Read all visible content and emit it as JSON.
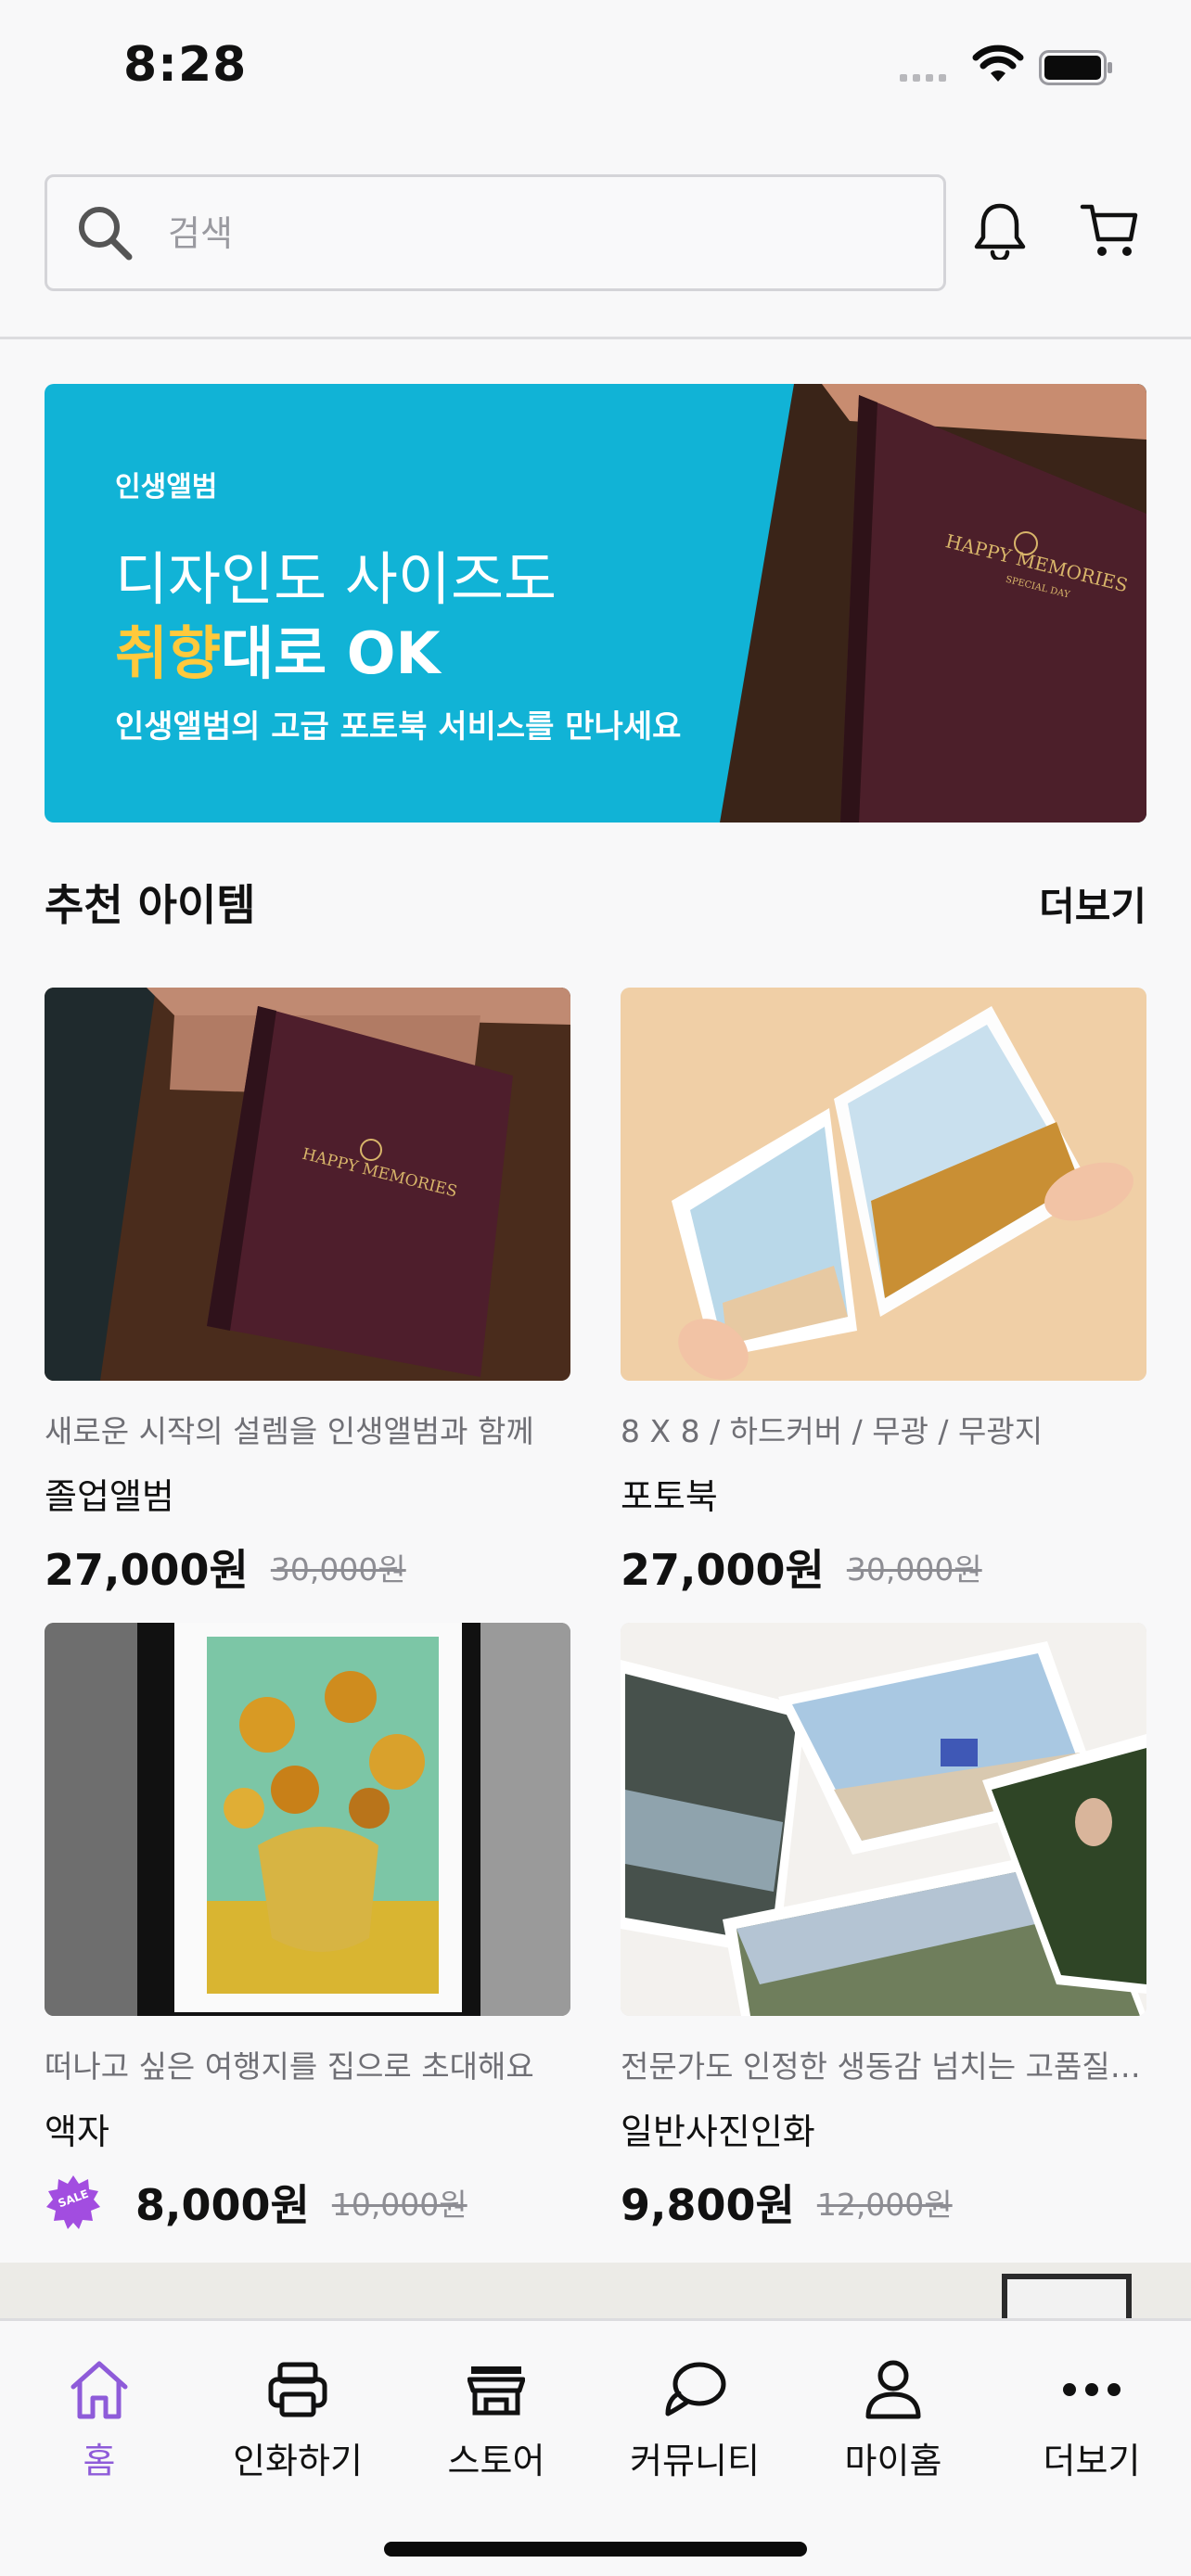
{
  "status_bar": {
    "time": "8:28"
  },
  "search": {
    "placeholder": "검색",
    "value": ""
  },
  "banner": {
    "eyebrow": "인생앨범",
    "line1": "디자인도 사이즈도",
    "line2_highlight": "취향",
    "line2_rest": "대로 OK",
    "subtitle": "인생앨범의 고급 포토북 서비스를 만나세요",
    "art_cover_title": "HAPPY MEMORIES",
    "art_cover_subtitle": "SPECIAL DAY",
    "background_color": "#11b3d6",
    "highlight_color": "#ffc93c"
  },
  "section": {
    "title": "추천 아이템",
    "more_label": "더보기"
  },
  "products": [
    {
      "desc": "새로운 시작의 설렘을 인생앨범과 함께",
      "name": "졸업앨범",
      "price": "27,000원",
      "original_price": "30,000원",
      "sale": false
    },
    {
      "desc": "8 X 8 / 하드커버 / 무광 / 무광지",
      "name": "포토북",
      "price": "27,000원",
      "original_price": "30,000원",
      "sale": false
    },
    {
      "desc": "떠나고 싶은 여행지를 집으로 초대해요",
      "name": "액자",
      "price": "8,000원",
      "original_price": "10,000원",
      "sale": true,
      "sale_label": "SALE"
    },
    {
      "desc": "전문가도 인정한 생동감 넘치는 고품질 인화",
      "name": "일반사진인화",
      "price": "9,800원",
      "original_price": "12,000원",
      "sale": false
    }
  ],
  "tabs": [
    {
      "label": "홈",
      "icon": "home-icon",
      "active": true
    },
    {
      "label": "인화하기",
      "icon": "printer-icon",
      "active": false
    },
    {
      "label": "스토어",
      "icon": "store-icon",
      "active": false
    },
    {
      "label": "커뮤니티",
      "icon": "chat-bubbles-icon",
      "active": false
    },
    {
      "label": "마이홈",
      "icon": "user-icon",
      "active": false
    },
    {
      "label": "더보기",
      "icon": "more-dots-icon",
      "active": false
    }
  ],
  "colors": {
    "accent": "#8e5bd9",
    "divider": "#dcdcdf"
  }
}
